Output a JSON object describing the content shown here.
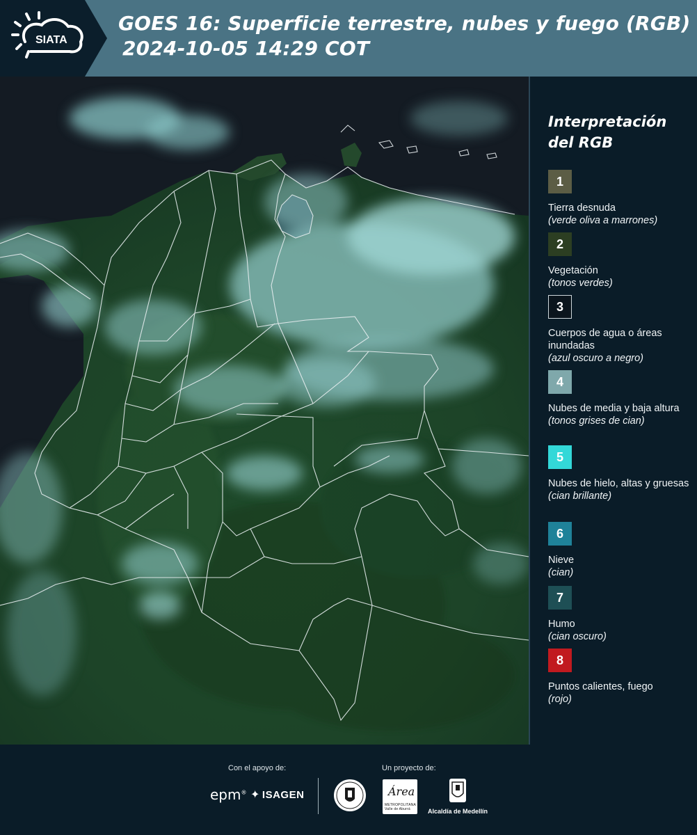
{
  "header": {
    "logo_text": "SIATA",
    "title_line1": "GOES 16: Superficie terrestre, nubes y fuego (RGB)",
    "title_line2": "2024-10-05 14:29 COT"
  },
  "legend": {
    "title_line1": "Interpretación",
    "title_line2": "del RGB",
    "items": [
      {
        "number": "1",
        "color": "#5c5d45",
        "label": "Tierra desnuda",
        "desc": "(verde oliva a marrones)"
      },
      {
        "number": "2",
        "color": "#2c3e22",
        "label": "Vegetación",
        "desc": "(tonos verdes)"
      },
      {
        "number": "3",
        "color": "#0b151d",
        "label": "Cuerpos de agua o áreas inundadas",
        "desc": "(azul oscuro a negro)"
      },
      {
        "number": "4",
        "color": "#7fa8ab",
        "label": "Nubes de media y baja altura",
        "desc": "(tonos grises de cian)"
      },
      {
        "number": "5",
        "color": "#33d8d8",
        "label": "Nubes de hielo, altas y gruesas",
        "desc": "(cian brillante)"
      },
      {
        "number": "6",
        "color": "#1f8299",
        "label": "Nieve",
        "desc": "(cian)"
      },
      {
        "number": "7",
        "color": "#1e4f55",
        "label": "Humo",
        "desc": "(cian oscuro)"
      },
      {
        "number": "8",
        "color": "#c11a1f",
        "label": "Puntos calientes, fuego",
        "desc": "(rojo)"
      }
    ]
  },
  "footer": {
    "support_label": "Con el apoyo de:",
    "project_label": "Un proyecto de:",
    "sponsor1": "epm",
    "sponsor2": "ISAGEN",
    "partner_area": "Área",
    "partner_area_sub": "METROPOLITANA Valle de Aburrá",
    "partner_medellin": "Alcaldía de Medellín"
  }
}
